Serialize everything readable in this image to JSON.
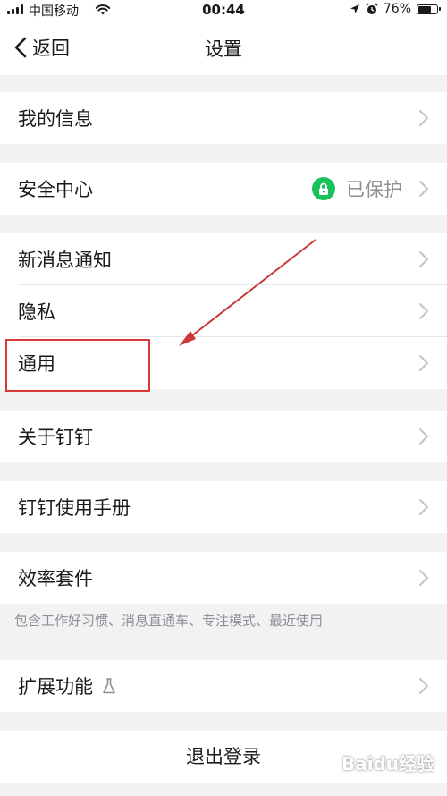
{
  "status": {
    "carrier": "中国移动",
    "time": "00:44",
    "battery": "76%",
    "battery_level": 0.76
  },
  "nav": {
    "back_label": "返回",
    "title": "设置"
  },
  "items": {
    "my_info": "我的信息",
    "security": "安全中心",
    "security_value": "已保护",
    "notifications": "新消息通知",
    "privacy": "隐私",
    "general": "通用",
    "about": "关于钉钉",
    "manual": "钉钉使用手册",
    "efficiency": "效率套件",
    "efficiency_note": "包含工作好习惯、消息直通车、专注模式、最近使用",
    "extensions": "扩展功能",
    "logout": "退出登录"
  },
  "watermark": "Baidu经验",
  "colors": {
    "accent_green": "#18c25a",
    "annotation_red": "#d83a3a"
  }
}
